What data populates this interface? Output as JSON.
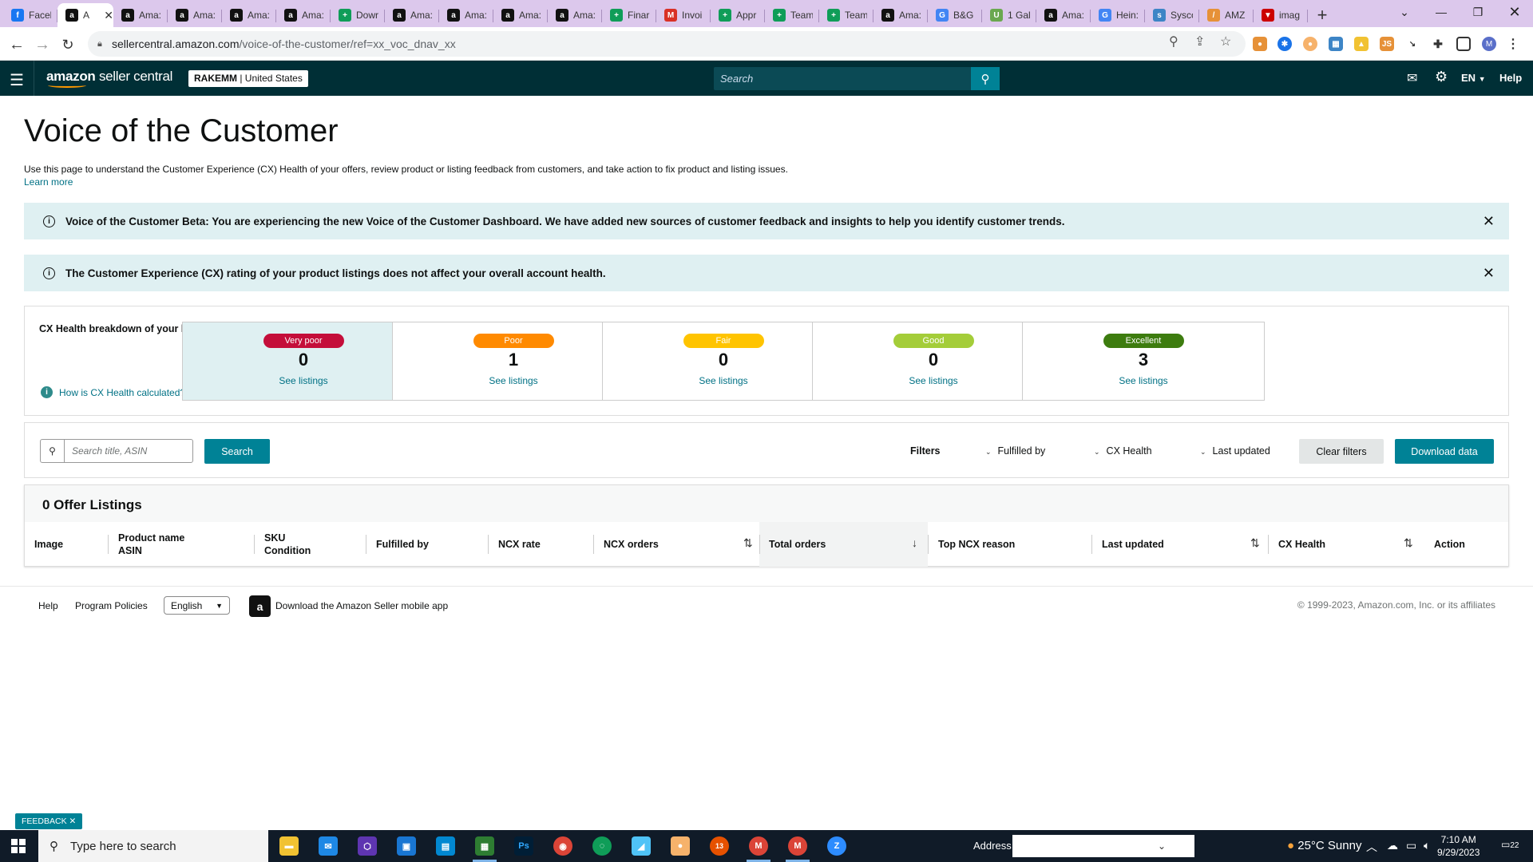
{
  "browser": {
    "tabs": [
      {
        "label": "Faceb",
        "icon": "facebook-icon",
        "color": "#1877f2",
        "glyph": "f"
      },
      {
        "label": "A",
        "icon": "amazon-icon",
        "color": "#111111",
        "glyph": "a",
        "active": true
      },
      {
        "label": "Ama:",
        "icon": "amazon-icon",
        "color": "#111111",
        "glyph": "a"
      },
      {
        "label": "Ama:",
        "icon": "amazon-icon",
        "color": "#111111",
        "glyph": "a"
      },
      {
        "label": "Ama:",
        "icon": "amazon-icon",
        "color": "#111111",
        "glyph": "a"
      },
      {
        "label": "Ama:",
        "icon": "amazon-icon",
        "color": "#111111",
        "glyph": "a"
      },
      {
        "label": "Dowr",
        "icon": "sheets-icon",
        "color": "#0f9d58",
        "glyph": "+"
      },
      {
        "label": "Ama:",
        "icon": "amazon-icon",
        "color": "#111111",
        "glyph": "a"
      },
      {
        "label": "Ama:",
        "icon": "amazon-icon",
        "color": "#111111",
        "glyph": "a"
      },
      {
        "label": "Ama:",
        "icon": "amazon-icon",
        "color": "#111111",
        "glyph": "a"
      },
      {
        "label": "Ama:",
        "icon": "amazon-icon",
        "color": "#111111",
        "glyph": "a"
      },
      {
        "label": "Finar",
        "icon": "sheets-icon",
        "color": "#0f9d58",
        "glyph": "+"
      },
      {
        "label": "Invoi",
        "icon": "gmail-icon",
        "color": "#d93025",
        "glyph": "M"
      },
      {
        "label": "Appr",
        "icon": "sheets-icon",
        "color": "#0f9d58",
        "glyph": "+"
      },
      {
        "label": "Team",
        "icon": "sheets-icon",
        "color": "#0f9d58",
        "glyph": "+"
      },
      {
        "label": "Team",
        "icon": "sheets-icon",
        "color": "#0f9d58",
        "glyph": "+"
      },
      {
        "label": "Ama:",
        "icon": "amazon-icon",
        "color": "#111111",
        "glyph": "a"
      },
      {
        "label": "B&G",
        "icon": "google-icon",
        "color": "#4285f4",
        "glyph": "G"
      },
      {
        "label": "1 Gal",
        "icon": "brand-icon",
        "color": "#6aa84f",
        "glyph": "U"
      },
      {
        "label": "Ama:",
        "icon": "amazon-icon",
        "color": "#111111",
        "glyph": "a"
      },
      {
        "label": "Hein:",
        "icon": "google-icon",
        "color": "#4285f4",
        "glyph": "G"
      },
      {
        "label": "Sysco",
        "icon": "sysco-icon",
        "color": "#3d85c6",
        "glyph": "s"
      },
      {
        "label": "AMZ",
        "icon": "brand-icon",
        "color": "#e69138",
        "glyph": "/"
      },
      {
        "label": "imag",
        "icon": "brand-icon",
        "color": "#cc0000",
        "glyph": "▼"
      }
    ],
    "url_host": "sellercentral.amazon.com",
    "url_path": "/voice-of-the-customer/ref=xx_voc_dnav_xx",
    "profile_initial": "M"
  },
  "header": {
    "logo_brand": "amazon",
    "logo_product": "seller central",
    "account_name": "RAKEMM",
    "account_region": "United States",
    "search_placeholder": "Search",
    "language": "EN",
    "help": "Help"
  },
  "page": {
    "title": "Voice of the Customer",
    "intro": "Use this page to understand the Customer Experience (CX) Health of your offers, review product or listing feedback from customers, and take action to fix product and listing issues.",
    "learn_more": "Learn more"
  },
  "alerts": [
    {
      "text": "Voice of the Customer Beta: You are experiencing the new Voice of the Customer Dashboard. We have added new sources of customer feedback and insights to help you identify customer trends."
    },
    {
      "text": "The Customer Experience (CX) rating of your product listings does not affect your overall account health."
    }
  ],
  "cx_health": {
    "heading": "CX Health breakdown of your listings",
    "how_link": "How is CX Health calculated?",
    "cards": [
      {
        "label": "Very poor",
        "count": "0",
        "link": "See listings",
        "color": "#c40e3a",
        "selected": true
      },
      {
        "label": "Poor",
        "count": "1",
        "link": "See listings",
        "color": "#ff8a00"
      },
      {
        "label": "Fair",
        "count": "0",
        "link": "See listings",
        "color": "#ffc400"
      },
      {
        "label": "Good",
        "count": "0",
        "link": "See listings",
        "color": "#a4cd39"
      },
      {
        "label": "Excellent",
        "count": "3",
        "link": "See listings",
        "color": "#3d7c0f"
      }
    ]
  },
  "filters": {
    "search_placeholder": "Search title, ASIN",
    "search_button": "Search",
    "filters_label": "Filters",
    "fulfilled_by": "Fulfilled by",
    "cx_health": "CX Health",
    "last_updated": "Last updated",
    "clear": "Clear filters",
    "download": "Download data"
  },
  "table": {
    "heading": "0 Offer Listings",
    "columns": [
      {
        "l1": "Image",
        "l2": ""
      },
      {
        "l1": "Product name",
        "l2": "ASIN"
      },
      {
        "l1": "SKU",
        "l2": "Condition"
      },
      {
        "l1": "Fulfilled by",
        "l2": ""
      },
      {
        "l1": "NCX rate",
        "l2": ""
      },
      {
        "l1": "NCX orders",
        "l2": ""
      },
      {
        "l1": "Total orders",
        "l2": ""
      },
      {
        "l1": "Top NCX reason",
        "l2": ""
      },
      {
        "l1": "Last updated",
        "l2": ""
      },
      {
        "l1": "CX Health",
        "l2": ""
      },
      {
        "l1": "Action",
        "l2": ""
      }
    ]
  },
  "footer": {
    "help": "Help",
    "policies": "Program Policies",
    "language": "English",
    "app": "Download the Amazon Seller mobile app",
    "copyright": "© 1999-2023, Amazon.com, Inc. or its affiliates",
    "feedback": "FEEDBACK"
  },
  "taskbar": {
    "search_placeholder": "Type here to search",
    "address_label": "Address",
    "weather": "25°C  Sunny",
    "time": "7:10 AM",
    "date": "9/29/2023",
    "notifications": "22",
    "badge": "13"
  },
  "colors": {
    "header_bg": "#002f36",
    "teal": "#008296",
    "alert_bg": "#dff0f2",
    "link": "#007185"
  }
}
